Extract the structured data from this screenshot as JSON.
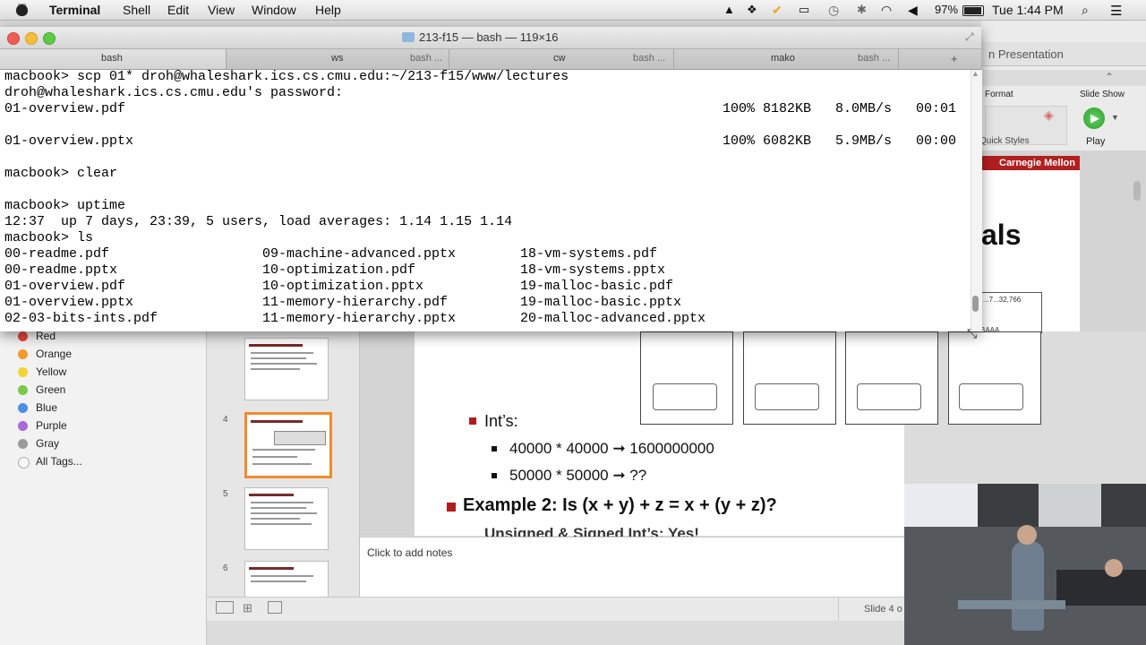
{
  "menubar": {
    "app_name": "Terminal",
    "items": [
      "Shell",
      "Edit",
      "View",
      "Window",
      "Help"
    ],
    "battery": "97%",
    "clock": "Tue 1:44 PM"
  },
  "terminal": {
    "title": "213-f15 — bash — 119×16",
    "tabs": [
      {
        "label": "bash",
        "sub": ""
      },
      {
        "label": "ws",
        "sub": "bash ..."
      },
      {
        "label": "cw",
        "sub": "bash ..."
      },
      {
        "label": "mako",
        "sub": "bash ..."
      }
    ],
    "lines": [
      {
        "text": "macbook> scp 01* droh@whaleshark.ics.cs.cmu.edu:~/213-f15/www/lectures",
        "progress": ""
      },
      {
        "text": "droh@whaleshark.ics.cs.cmu.edu's password:",
        "progress": ""
      },
      {
        "text": "01-overview.pdf",
        "progress": "100% 8182KB   8.0MB/s   00:01"
      },
      {
        "text": "",
        "progress": ""
      },
      {
        "text": "01-overview.pptx",
        "progress": "100% 6082KB   5.9MB/s   00:00"
      },
      {
        "text": "",
        "progress": ""
      },
      {
        "text": "macbook> clear",
        "progress": ""
      },
      {
        "text": "",
        "progress": ""
      },
      {
        "text": "macbook> uptime",
        "progress": ""
      },
      {
        "text": "12:37  up 7 days, 23:39, 5 users, load averages: 1.14 1.15 1.14",
        "progress": ""
      },
      {
        "text": "macbook> ls",
        "progress": ""
      }
    ],
    "ls_rows": [
      [
        "00-readme.pdf",
        "09-machine-advanced.pptx",
        "18-vm-systems.pdf"
      ],
      [
        "00-readme.pptx",
        "10-optimization.pdf",
        "18-vm-systems.pptx"
      ],
      [
        "01-overview.pdf",
        "10-optimization.pptx",
        "19-malloc-basic.pdf"
      ],
      [
        "01-overview.pptx",
        "11-memory-hierarchy.pdf",
        "19-malloc-basic.pptx"
      ],
      [
        "02-03-bits-ints.pdf",
        "11-memory-hierarchy.pptx",
        "20-malloc-advanced.pptx"
      ]
    ]
  },
  "ribbon": {
    "search_hint": "n Presentation",
    "format_label": "Format",
    "slideshow_label": "Slide Show",
    "quick_styles": "Quick Styles",
    "play": "Play",
    "brand": "Carnegie Mellon",
    "title_fragment": "als",
    "comic_text": "...7...32,766",
    "comic_sound": "BAAA"
  },
  "tags": {
    "items": [
      {
        "label": "Red",
        "color": "#e8453c"
      },
      {
        "label": "Orange",
        "color": "#f29a2e"
      },
      {
        "label": "Yellow",
        "color": "#f2d531"
      },
      {
        "label": "Green",
        "color": "#7cc84a"
      },
      {
        "label": "Blue",
        "color": "#4a8fe8"
      },
      {
        "label": "Purple",
        "color": "#a868d8"
      },
      {
        "label": "Gray",
        "color": "#9a9a9a"
      }
    ],
    "all_tags": "All Tags..."
  },
  "thumbnails": {
    "numbers": [
      "4",
      "5",
      "6"
    ]
  },
  "slide": {
    "bullet1": "Int’s:",
    "sub1": "40000 * 40000  ➞ 1600000000",
    "sub2": "50000 * 50000  ➞ ??",
    "example2": "Example 2: Is (x + y) + z  =  x + (y + z)?",
    "cutoff": "Unsigned & Signed Int’s: Yes!"
  },
  "notes": {
    "placeholder": "Click to add notes"
  },
  "status": {
    "slide_label": "Slide 4 o"
  }
}
